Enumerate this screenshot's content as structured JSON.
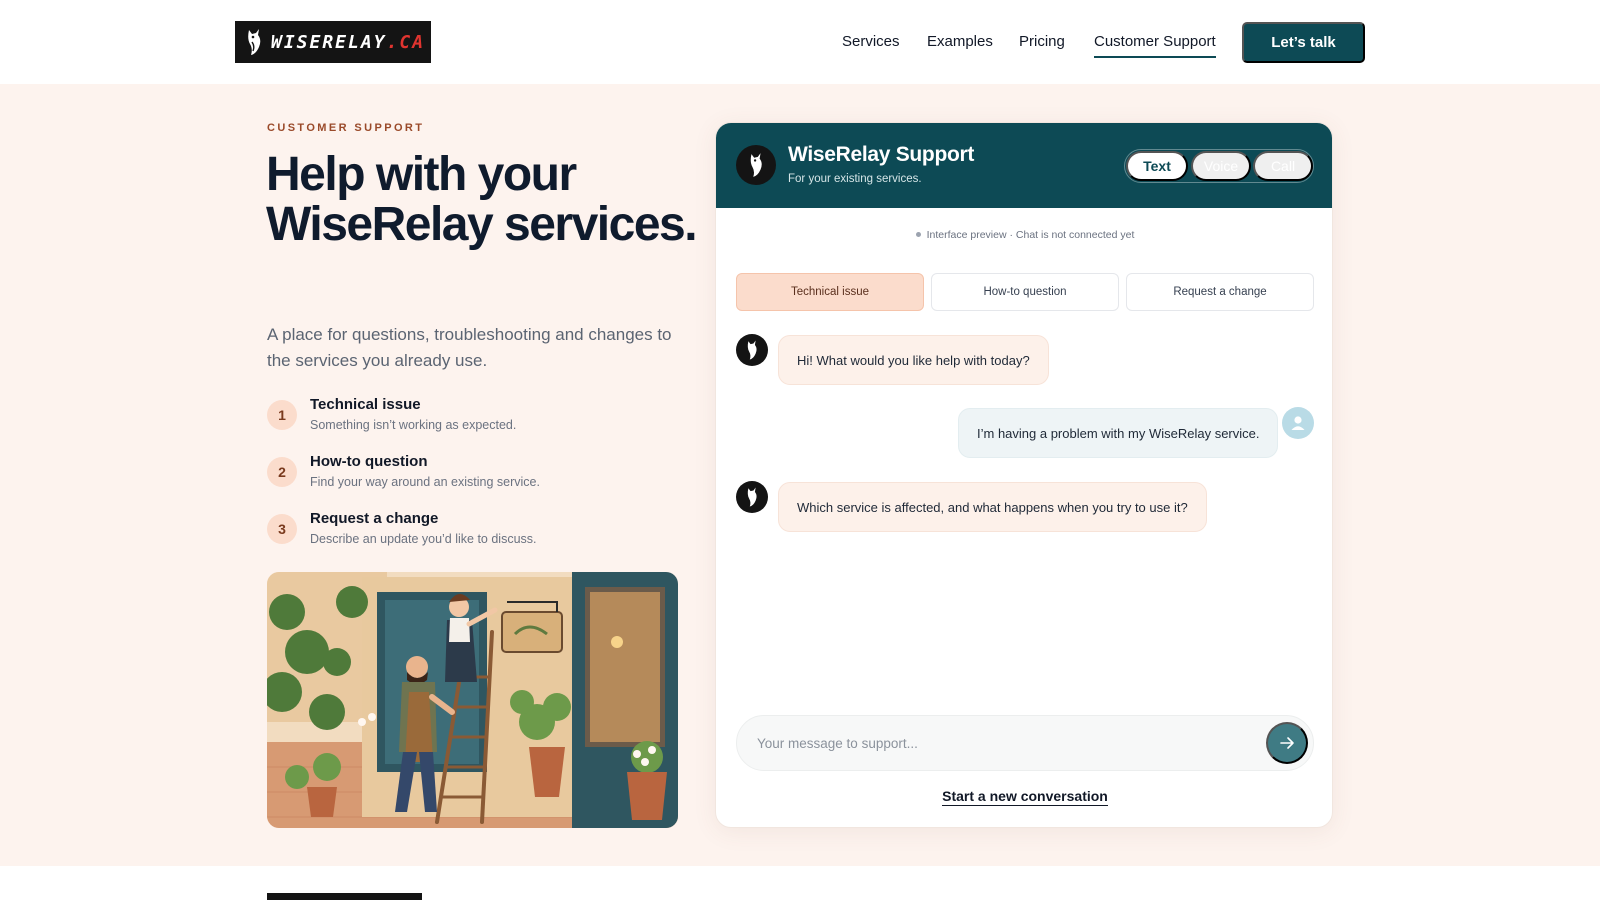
{
  "header": {
    "logo": {
      "text_main": "WISERELAY",
      "text_tld": ".CA"
    },
    "nav": [
      {
        "label": "Services"
      },
      {
        "label": "Examples"
      },
      {
        "label": "Pricing"
      },
      {
        "label": "Customer Support",
        "active": true
      }
    ],
    "cta_label": "Let’s talk"
  },
  "hero": {
    "eyebrow": "CUSTOMER SUPPORT",
    "title": "Help with your WiseRelay services.",
    "lead": "A place for questions, troubleshooting and changes to the services you already use.",
    "steps": [
      {
        "num": "1",
        "title": "Technical issue",
        "desc": "Something isn’t working as expected."
      },
      {
        "num": "2",
        "title": "How-to question",
        "desc": "Find your way around an existing service."
      },
      {
        "num": "3",
        "title": "Request a change",
        "desc": "Describe an update you’d like to discuss."
      }
    ]
  },
  "chat": {
    "title": "WiseRelay Support",
    "subtitle": "For your existing services.",
    "modes": [
      {
        "label": "Text",
        "active": true
      },
      {
        "label": "Voice"
      },
      {
        "label": "Call"
      }
    ],
    "preview_note": "Interface preview · Chat is not connected yet",
    "topics": [
      {
        "label": "Technical issue",
        "active": true
      },
      {
        "label": "How-to question"
      },
      {
        "label": "Request a change"
      }
    ],
    "messages": [
      {
        "from": "bot",
        "text": "Hi! What would you like help with today?"
      },
      {
        "from": "user",
        "text": "I’m having a problem with my WiseRelay service."
      },
      {
        "from": "bot",
        "text": "Which service is affected, and what happens when you try to use it?"
      }
    ],
    "input_placeholder": "Your message to support...",
    "restart_label": "Start a new conversation"
  },
  "colors": {
    "brand_teal": "#0d4a55",
    "hero_bg": "#fdf3ee",
    "accent_peach": "#fbdccc",
    "logo_red": "#e0342f"
  }
}
